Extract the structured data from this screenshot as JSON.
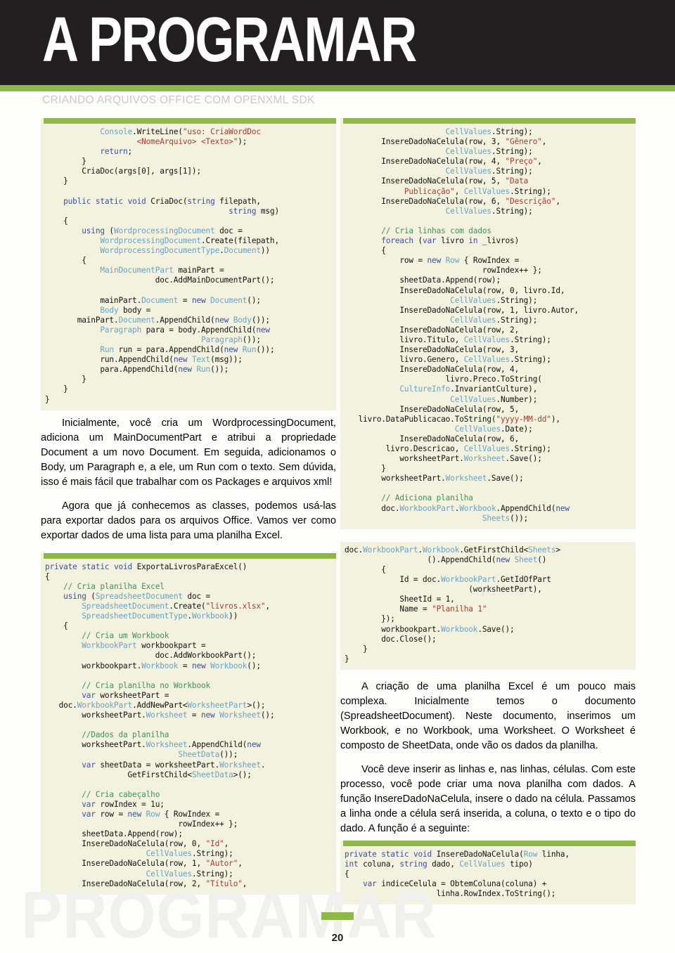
{
  "magazine": {
    "title": "A PROGRAMAR",
    "section_label": "CRIANDO ARQUIVOS OFFICE COM OPENXML SDK",
    "watermark": "PROGRAMAR",
    "page_number": "20"
  },
  "colors": {
    "accent_green": "#8fb74a",
    "masthead_dark": "#231f20",
    "code_background": "#f2f2de",
    "keyword": "#3a4fa0",
    "type": "#69a1c4",
    "string": "#a33a33",
    "comment": "#3f8f5f"
  },
  "left_column": {
    "code_block_1": "            Console.WriteLine(\"uso: CriaWordDoc\n                    <NomeArquivo> <Texto>\");\n            return;\n        }\n        CriaDoc(args[0], args[1]);\n    }\n\n    public static void CriaDoc(string filepath,\n                                        string msg)\n    {\n        using (WordprocessingDocument doc =\n            WordprocessingDocument.Create(filepath,\n            WordprocessingDocumentType.Document))\n        {\n            MainDocumentPart mainPart =\n                        doc.AddMainDocumentPart();\n\n            mainPart.Document = new Document();\n            Body body =\n       mainPart.Document.AppendChild(new Body());\n            Paragraph para = body.AppendChild(new\n                                  Paragraph());\n            Run run = para.AppendChild(new Run());\n            run.AppendChild(new Text(msg));\n            para.AppendChild(new Run());\n        }\n    }\n}",
    "paragraph_1": "Inicialmente, você cria um WordprocessingDocument, adiciona um MainDocumentPart e atribui a propriedade Document a um novo Document. Em seguida, adicionamos o Body, um Paragraph e, a ele, um Run com o texto. Sem dúvida, isso é mais fácil que trabalhar com os Packages e arquivos xml!",
    "paragraph_2": "Agora que já conhecemos as classes, podemos usá-las para exportar dados para os arquivos Office. Vamos ver como exportar dados de uma lista para uma planilha Excel.",
    "code_block_2": "private static void ExportaLivrosParaExcel()\n{\n    // Cria planilha Excel\n    using (SpreadsheetDocument doc =\n        SpreadsheetDocument.Create(\"livros.xlsx\",\n        SpreadsheetDocumentType.Workbook))\n    {\n        // Cria um Workbook\n        WorkbookPart workbookpart =\n                        doc.AddWorkbookPart();\n        workbookpart.Workbook = new Workbook();\n\n        // Cria planilha no Workbook\n        var worksheetPart =\n   doc.WorkbookPart.AddNewPart<WorksheetPart>();\n        worksheetPart.Worksheet = new Worksheet();\n\n        //Dados da planilha\n        worksheetPart.Worksheet.AppendChild(new\n                             SheetData());\n        var sheetData = worksheetPart.Worksheet.\n                  GetFirstChild<SheetData>();\n\n        // Cria cabeçalho\n        var rowIndex = 1u;\n        var row = new Row { RowIndex =\n                             rowIndex++ };\n        sheetData.Append(row);\n        InsereDadoNaCelula(row, 0, \"Id\",\n                      CellValues.String);\n        InsereDadoNaCelula(row, 1, \"Autor\",\n                      CellValues.String);\n        InsereDadoNaCelula(row, 2, \"Título\","
  },
  "right_column": {
    "code_block_1": "                      CellValues.String);\n        InsereDadoNaCelula(row, 3, \"Gênero\",\n                      CellValues.String);\n        InsereDadoNaCelula(row, 4, \"Preço\",\n                      CellValues.String);\n        InsereDadoNaCelula(row, 5, \"Data\n             Publicação\", CellValues.String);\n        InsereDadoNaCelula(row, 6, \"Descrição\",\n                      CellValues.String);\n\n        // Cria linhas com dados\n        foreach (var livro in _livros)\n        {\n            row = new Row { RowIndex =\n                              rowIndex++ };\n            sheetData.Append(row);\n            InsereDadoNaCelula(row, 0, livro.Id,\n                       CellValues.String);\n            InsereDadoNaCelula(row, 1, livro.Autor,\n                       CellValues.String);\n            InsereDadoNaCelula(row, 2,\n            livro.Titulo, CellValues.String);\n            InsereDadoNaCelula(row, 3,\n            livro.Genero, CellValues.String);\n            InsereDadoNaCelula(row, 4,\n                      livro.Preco.ToString(\n            CultureInfo.InvariantCulture),\n                       CellValues.Number);\n            InsereDadoNaCelula(row, 5,\n   livro.DataPublicacao.ToString(\"yyyy-MM-dd\"),\n                        CellValues.Date);\n            InsereDadoNaCelula(row, 6,\n         livro.Descricao, CellValues.String);\n            worksheetPart.Worksheet.Save();\n        }\n        worksheetPart.Worksheet.Save();\n\n        // Adiciona planilha\n        doc.WorkbookPart.Workbook.AppendChild(new\n                              Sheets());",
    "code_block_2": "doc.WorkbookPart.Workbook.GetFirstChild<Sheets>\n                  ().AppendChild(new Sheet()\n        {\n            Id = doc.WorkbookPart.GetIdOfPart\n                           (worksheetPart),\n            SheetId = 1,\n            Name = \"Planilha 1\"\n        });\n        workbookpart.Workbook.Save();\n        doc.Close();\n    }\n}",
    "paragraph_1": "A criação de uma planilha Excel é um pouco mais complexa. Inicialmente temos o documento (SpreadsheetDocument). Neste documento, inserimos um Workbook, e no Workbook, uma Worksheet. O Worksheet é composto de SheetData, onde vão os dados da planilha.",
    "paragraph_2": "Você deve inserir as linhas e, nas linhas, células. Com este processo, você pode criar uma nova planilha com dados. A função InsereDadoNaCelula, insere o dado na célula. Passamos a linha onde a célula será inserida, a coluna, o texto e o tipo do dado. A função é a seguinte:",
    "code_block_3": "private static void InsereDadoNaCelula(Row linha,\nint coluna, string dado, CellValues tipo)\n{\n    var indiceCelula = ObtemColuna(coluna) +\n                    linha.RowIndex.ToString();"
  }
}
